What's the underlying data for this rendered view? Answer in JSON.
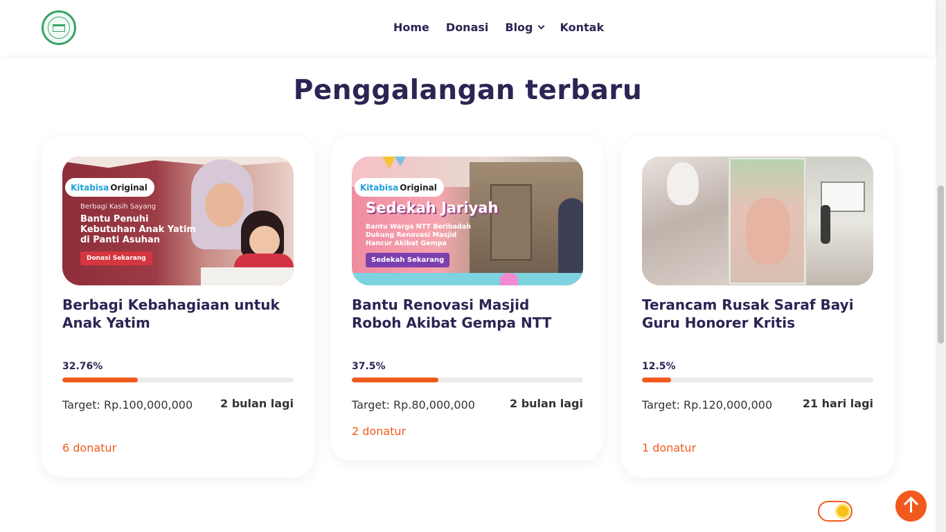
{
  "nav": {
    "logo_alt": "Logo",
    "items": [
      {
        "label": "Home"
      },
      {
        "label": "Donasi"
      },
      {
        "label": "Blog"
      },
      {
        "label": "Kontak"
      }
    ]
  },
  "section": {
    "title": "Penggalangan terbaru"
  },
  "campaigns": [
    {
      "title": "Berbagi Kebahagiaan untuk Anak Yatim",
      "progress_label": "32.76%",
      "progress": 0.3276,
      "target": "Target: Rp.100,000,000",
      "remaining": "2 bulan lagi",
      "donors": "6 donatur",
      "banner": {
        "brand": "Kitabisa",
        "brand_suffix": "Original",
        "kicker": "Berbagi Kasih Sayang",
        "headline": "Bantu Penuhi Kebutuhan Anak Yatim di Panti Asuhan",
        "cta": "Donasi Sekarang"
      }
    },
    {
      "title": "Bantu Renovasi Masjid Roboh Akibat Gempa NTT",
      "progress_label": "37.5%",
      "progress": 0.375,
      "target": "Target: Rp.80,000,000",
      "remaining": "2 bulan lagi",
      "donors": "2 donatur",
      "banner": {
        "brand": "Kitabisa",
        "brand_suffix": "Original",
        "headline": "Sedekah Jariyah",
        "subline": "Bantu Warga NTT Beribadah Dukung Renovasi Masjid Hancur Akibat Gempa",
        "cta": "Sedekah Sekarang"
      }
    },
    {
      "title": "Terancam Rusak Saraf Bayi Guru Honorer Kritis",
      "progress_label": "12.5%",
      "progress": 0.125,
      "target": "Target: Rp.120,000,000",
      "remaining": "21 hari lagi",
      "donors": "1 donatur"
    }
  ],
  "colors": {
    "accent": "#f15a1c",
    "heading": "#2a2553",
    "track": "#eceaea"
  },
  "icons": {
    "logo": "foundation-seal-icon",
    "to_top": "arrow-up-icon",
    "theme": "sun-icon"
  }
}
